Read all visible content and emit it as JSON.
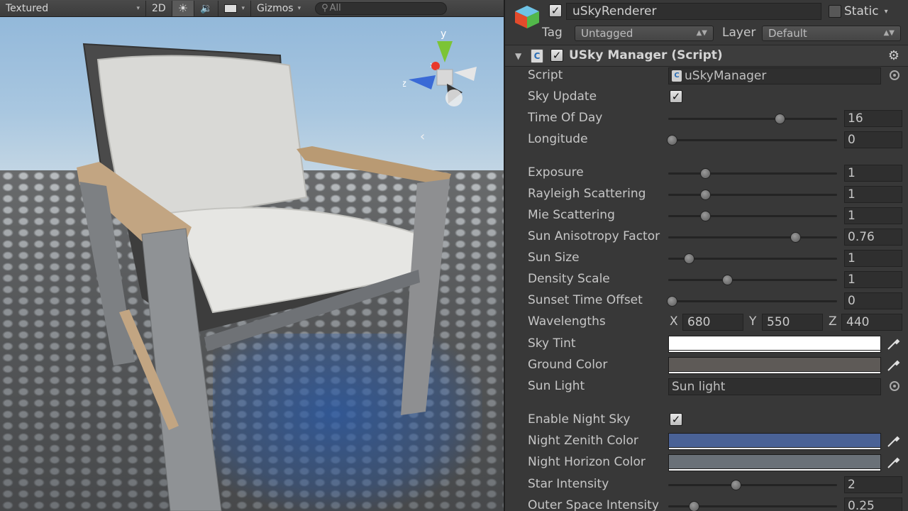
{
  "scene_toolbar": {
    "shading_mode": "Textured",
    "mode_2d": "2D",
    "gizmos": "Gizmos",
    "search_placeholder": "All"
  },
  "gizmo": {
    "y_label": "y",
    "x_label": "x",
    "z_label": "z"
  },
  "inspector": {
    "object_name": "uSkyRenderer",
    "static_label": "Static",
    "tag_label": "Tag",
    "tag_value": "Untagged",
    "layer_label": "Layer",
    "layer_value": "Default",
    "component_title": "USky Manager (Script)",
    "rows": {
      "script": {
        "label": "Script",
        "value": "uSkyManager"
      },
      "sky_update": {
        "label": "Sky Update",
        "checked": true
      },
      "time_of_day": {
        "label": "Time Of Day",
        "value": "16",
        "fraction": 0.66
      },
      "longitude": {
        "label": "Longitude",
        "value": "0",
        "fraction": 0.02
      },
      "exposure": {
        "label": "Exposure",
        "value": "1",
        "fraction": 0.22
      },
      "rayleigh": {
        "label": "Rayleigh Scattering",
        "value": "1",
        "fraction": 0.22
      },
      "mie": {
        "label": "Mie Scattering",
        "value": "1",
        "fraction": 0.22
      },
      "sun_anisotropy": {
        "label": "Sun Anisotropy Factor",
        "value": "0.76",
        "fraction": 0.75
      },
      "sun_size": {
        "label": "Sun Size",
        "value": "1",
        "fraction": 0.12
      },
      "density_scale": {
        "label": "Density Scale",
        "value": "1",
        "fraction": 0.35
      },
      "sunset_offset": {
        "label": "Sunset Time Offset",
        "value": "0",
        "fraction": 0.02
      },
      "wavelengths": {
        "label": "Wavelengths",
        "x_label": "X",
        "x": "680",
        "y_label": "Y",
        "y": "550",
        "z_label": "Z",
        "z": "440"
      },
      "sky_tint": {
        "label": "Sky Tint",
        "color": "#ffffff"
      },
      "ground_color": {
        "label": "Ground Color",
        "color": "#5e5a57"
      },
      "sun_light": {
        "label": "Sun Light",
        "value": "Sun light"
      },
      "enable_night_sky": {
        "label": "Enable Night Sky",
        "checked": true
      },
      "night_zenith": {
        "label": "Night Zenith Color",
        "color": "#4a6296"
      },
      "night_horizon": {
        "label": "Night Horizon Color",
        "color": "#6a7178"
      },
      "star_intensity": {
        "label": "Star Intensity",
        "value": "2",
        "fraction": 0.4
      },
      "outer_space": {
        "label": "Outer Space Intensity",
        "value": "0.25",
        "fraction": 0.15
      }
    }
  }
}
